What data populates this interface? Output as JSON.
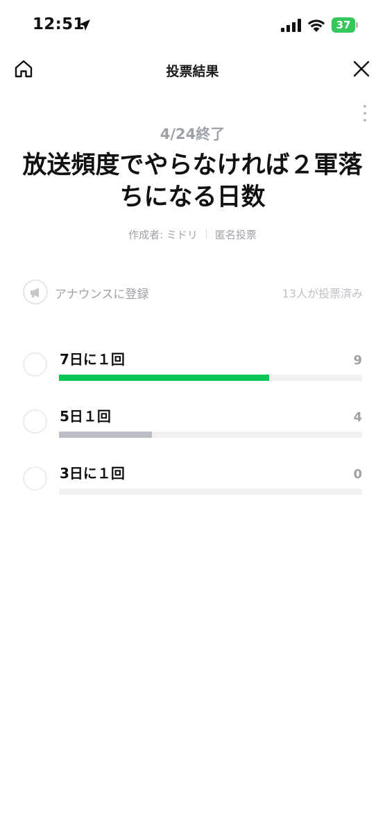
{
  "status_bar": {
    "time": "12:51",
    "battery_level": "37",
    "battery_color": "#34c759"
  },
  "nav": {
    "title": "投票結果"
  },
  "poll": {
    "end_date": "4/24終了",
    "title": "放送頻度でやらなければ２軍落ちになる日数",
    "creator": "作成者: ミドリ",
    "vote_type": "匿名投票",
    "announce_label": "アナウンスに登録",
    "voted_count": "13人が投票済み",
    "total_votes": 13,
    "options": [
      {
        "label": "7日に１回",
        "count": "9",
        "votes": 9,
        "bar_color": "#06c755"
      },
      {
        "label": "5日１回",
        "count": "4",
        "votes": 4,
        "bar_color": "#babdc3"
      },
      {
        "label": "3日に１回",
        "count": "0",
        "votes": 0,
        "bar_color": "#babdc3"
      }
    ]
  }
}
